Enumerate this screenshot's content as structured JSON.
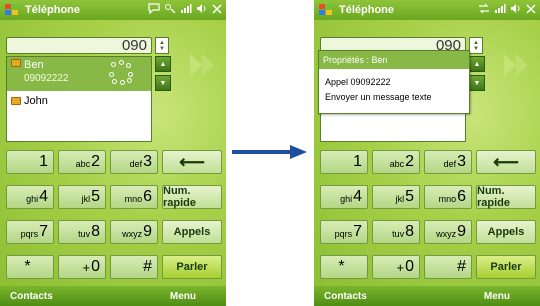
{
  "left_screen": {
    "title": "Téléphone",
    "dialed_number": "090",
    "contacts": [
      {
        "name": "Ben",
        "number": "09092222"
      },
      {
        "name": "John"
      }
    ],
    "keys": {
      "k1": {
        "sub": "",
        "main": "1"
      },
      "k2": {
        "sub": "abc",
        "main": "2"
      },
      "k3": {
        "sub": "def",
        "main": "3"
      },
      "k4": {
        "sub": "ghi",
        "main": "4"
      },
      "k5": {
        "sub": "jkl",
        "main": "5"
      },
      "k6": {
        "sub": "mno",
        "main": "6"
      },
      "k7": {
        "sub": "pqrs",
        "main": "7"
      },
      "k8": {
        "sub": "tuv",
        "main": "8"
      },
      "k9": {
        "sub": "wxyz",
        "main": "9"
      },
      "kstar": "*",
      "k0": {
        "sub": "+",
        "main": "0"
      },
      "khash": "#",
      "backspace": "⟵",
      "speed_dial": "Num. rapide",
      "calls": "Appels",
      "talk": "Parler"
    },
    "softkeys": {
      "left": "Contacts",
      "right": "Menu"
    }
  },
  "right_screen": {
    "title": "Téléphone",
    "dialed_number": "090",
    "menu": {
      "header": "Propriétés : Ben",
      "items": [
        "Appel 09092222",
        "Envoyer un message texte"
      ]
    },
    "keys": {
      "k1": {
        "sub": "",
        "main": "1"
      },
      "k2": {
        "sub": "abc",
        "main": "2"
      },
      "k3": {
        "sub": "def",
        "main": "3"
      },
      "k4": {
        "sub": "ghi",
        "main": "4"
      },
      "k5": {
        "sub": "jkl",
        "main": "5"
      },
      "k6": {
        "sub": "mno",
        "main": "6"
      },
      "k7": {
        "sub": "pqrs",
        "main": "7"
      },
      "k8": {
        "sub": "tuv",
        "main": "8"
      },
      "k9": {
        "sub": "wxyz",
        "main": "9"
      },
      "kstar": "*",
      "k0": {
        "sub": "+",
        "main": "0"
      },
      "khash": "#",
      "backspace": "⟵",
      "speed_dial": "Num. rapide",
      "calls": "Appels",
      "talk": "Parler"
    },
    "softkeys": {
      "left": "Contacts",
      "right": "Menu"
    }
  },
  "colors": {
    "title_bar": "#6aa81f",
    "selection": "#88b846",
    "arrow": "#1f4e9c"
  }
}
